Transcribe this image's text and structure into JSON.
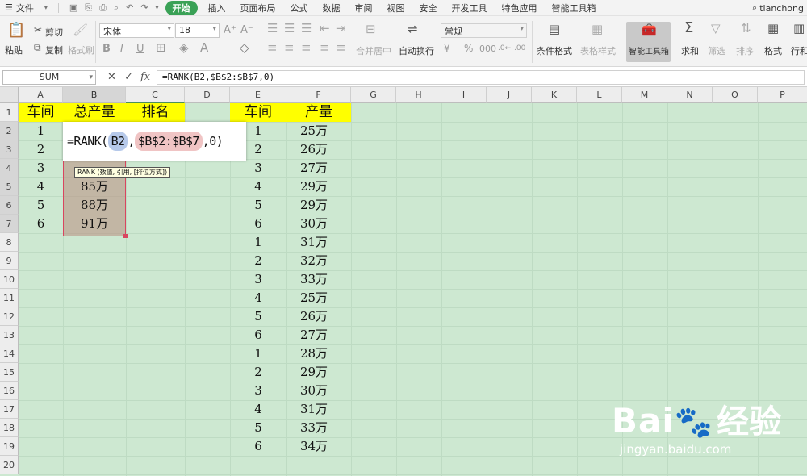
{
  "menubar": {
    "file_label": "文件",
    "tabs": [
      "开始",
      "插入",
      "页面布局",
      "公式",
      "数据",
      "审阅",
      "视图",
      "安全",
      "开发工具",
      "特色应用",
      "智能工具箱"
    ],
    "active_tab": "开始",
    "user": "tianchong"
  },
  "toolbar": {
    "paste": "粘贴",
    "cut": "剪切",
    "copy": "复制",
    "format_painter": "格式刷",
    "font_name": "宋体",
    "font_size": "18",
    "merge_center": "合并居中",
    "wrap_text": "自动换行",
    "number_format": "常规",
    "conditional_format": "条件格式",
    "table_style": "表格样式",
    "smart_toolbox": "智能工具箱",
    "sum": "求和",
    "filter": "筛选",
    "sort": "排序",
    "format": "格式",
    "row_col": "行和",
    "bold": "B",
    "italic": "I",
    "underline": "U",
    "percent": "%"
  },
  "formula_bar": {
    "name_box": "SUM",
    "fx": "fx",
    "formula": "=RANK(B2,$B$2:$B$7,0)"
  },
  "sheet": {
    "columns": [
      "A",
      "B",
      "C",
      "D",
      "E",
      "F",
      "G",
      "H",
      "I",
      "J",
      "K",
      "L",
      "M",
      "N",
      "O",
      "P"
    ],
    "rows": [
      "1",
      "2",
      "3",
      "4",
      "5",
      "6",
      "7",
      "8",
      "9",
      "10",
      "11",
      "12",
      "13",
      "14",
      "15",
      "16",
      "17",
      "18",
      "19",
      "20"
    ],
    "header_A": "车间",
    "header_B": "总产量",
    "header_C": "排名",
    "header_E": "车间",
    "header_F": "产量",
    "col_A": [
      "1",
      "2",
      "3",
      "4",
      "5",
      "6"
    ],
    "col_B": [
      "85万",
      "88万",
      "91万"
    ],
    "col_E": [
      "1",
      "2",
      "3",
      "4",
      "5",
      "6",
      "1",
      "2",
      "3",
      "4",
      "5",
      "6",
      "1",
      "2",
      "3",
      "4",
      "5",
      "6"
    ],
    "col_F": [
      "25万",
      "26万",
      "27万",
      "29万",
      "29万",
      "30万",
      "31万",
      "32万",
      "33万",
      "25万",
      "26万",
      "27万",
      "28万",
      "29万",
      "30万",
      "31万",
      "33万",
      "34万"
    ]
  },
  "editor": {
    "prefix": "=RANK(",
    "ref1": "B2",
    "comma1": ",",
    "ref2": "$B$2:$B$7",
    "suffix": ",0)"
  },
  "tooltip": "RANK (数值, 引用, [排位方式])",
  "watermark": {
    "brand": "Bai",
    "brand2": "经验",
    "url": "jingyan.baidu.com"
  },
  "colors": {
    "grid_bg": "#cde8d1",
    "header_yellow": "#ffff00",
    "active_tab": "#3aa156",
    "selection_border": "#d9455f"
  }
}
